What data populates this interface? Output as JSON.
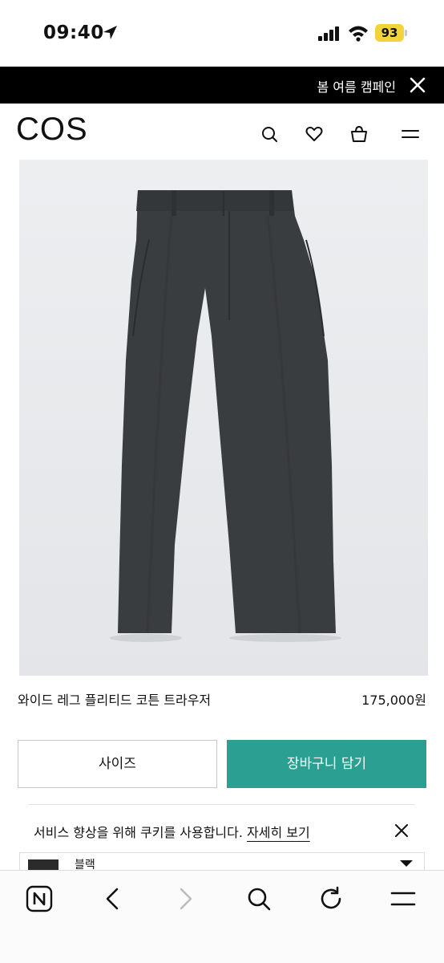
{
  "status_bar": {
    "time": "09:40",
    "battery": "93"
  },
  "banner": {
    "text": "봄 여름 캠페인"
  },
  "header": {
    "logo": "COS",
    "icons": [
      "search-icon",
      "heart-icon",
      "bag-icon",
      "menu-icon"
    ]
  },
  "product": {
    "name": "와이드 레그 플리티드 코튼 트라우저",
    "price": "175,000원",
    "image": "charcoal-wide-leg-trousers"
  },
  "actions": {
    "size_label": "사이즈",
    "cart_label": "장바구니 담기"
  },
  "cookie": {
    "text": "서비스 향상을 위해 쿠키를 사용합니다. ",
    "link": "자세히 보기"
  },
  "color": {
    "label": "블랙",
    "swatch": "#2b2b2b"
  },
  "colors": {
    "accent": "#2a9f92",
    "banner_bg": "#000000",
    "battery": "#f2d33a"
  },
  "browser_toolbar": {
    "icons": [
      "naver-icon",
      "back-icon",
      "forward-icon",
      "search-icon",
      "reload-icon",
      "menu-icon"
    ]
  }
}
